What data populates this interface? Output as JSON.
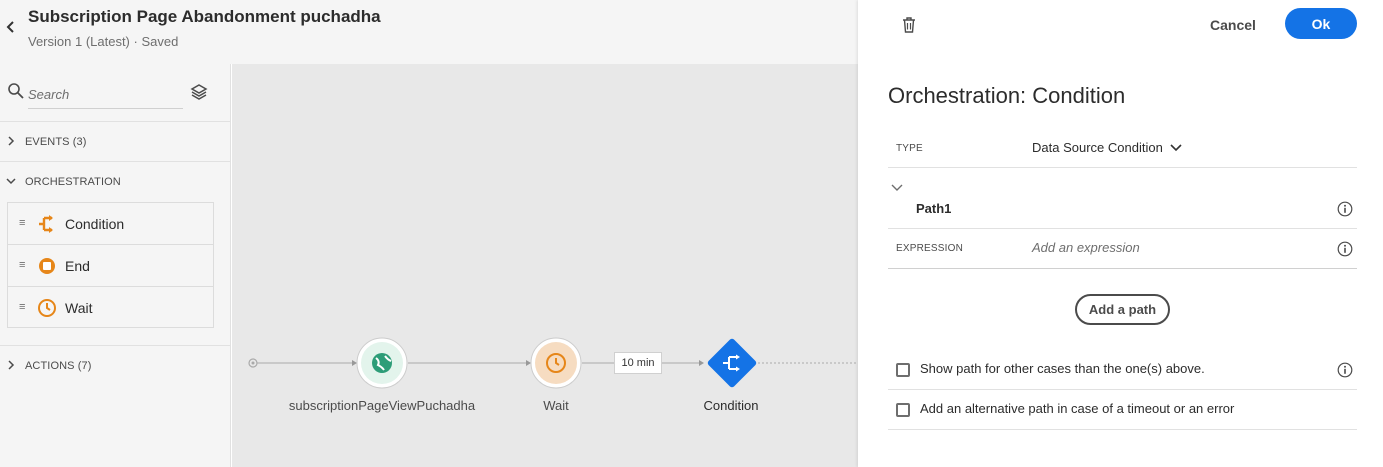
{
  "header": {
    "title": "Subscription Page Abandonment puchadha",
    "subtitle": "Version 1 (Latest) · Saved",
    "back_icon": "chevron-left-icon"
  },
  "palette": {
    "search_placeholder": "Search",
    "sections": {
      "events": "EVENTS (3)",
      "orchestration": "ORCHESTRATION",
      "actions": "ACTIONS (7)"
    },
    "orchestration_items": [
      {
        "label": "Condition",
        "icon": "condition-icon"
      },
      {
        "label": "End",
        "icon": "end-icon"
      },
      {
        "label": "Wait",
        "icon": "wait-icon"
      }
    ],
    "drag_handle": "≡"
  },
  "canvas": {
    "nodes": [
      {
        "label": "subscriptionPageViewPuchadha",
        "icon": "globe-icon",
        "color": "#2d9d78"
      },
      {
        "label": "Wait",
        "icon": "clock-icon",
        "color": "#e68619"
      },
      {
        "label": "Condition",
        "icon": "condition-icon",
        "color": "#1473e6"
      }
    ],
    "wait_badge": "10 min"
  },
  "panel": {
    "cancel_label": "Cancel",
    "ok_label": "Ok",
    "title": "Orchestration: Condition",
    "type_label": "TYPE",
    "type_value": "Data Source Condition",
    "path_name": "Path1",
    "expression_label": "EXPRESSION",
    "expression_placeholder": "Add an expression",
    "add_path_label": "Add a path",
    "checkbox_other": "Show path for other cases than the one(s) above.",
    "checkbox_timeout": "Add an alternative path in case of a timeout or an error"
  },
  "colors": {
    "accent": "#1473e6",
    "orange": "#e68619",
    "green": "#2d9d78"
  }
}
